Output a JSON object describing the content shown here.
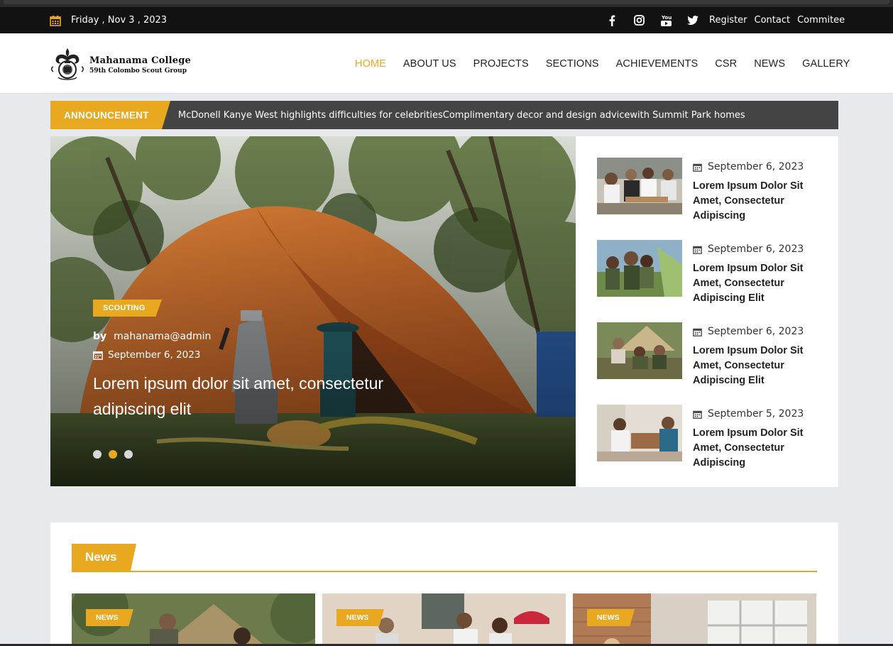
{
  "topbar": {
    "date": "Friday , Nov 3 , 2023",
    "social_icons": [
      "facebook-icon",
      "instagram-icon",
      "youtube-icon",
      "twitter-icon"
    ],
    "youtube_text": "You",
    "links": [
      "Register",
      "Contact",
      "Commitee"
    ]
  },
  "logo": {
    "line1": "Mahanama College",
    "line2": "59th Colombo Scout Group"
  },
  "nav": {
    "items": [
      "HOME",
      "ABOUT US",
      "PROJECTS",
      "SECTIONS",
      "ACHIEVEMENTS",
      "CSR",
      "NEWS",
      "GALLERY"
    ],
    "active": "HOME"
  },
  "announcement": {
    "label": "ANNOUNCEMENT",
    "text": "McDonell Kanye West highlights difficulties for celebritiesComplimentary decor and design advicewith Summit Park homes"
  },
  "hero": {
    "category": "SCOUTING",
    "by_label": "by",
    "author": "mahanama@admin",
    "date": "September 6, 2023",
    "headline": "Lorem ipsum dolor sit amet, consectetur adipiscing elit",
    "slides": 3,
    "active_slide": 2
  },
  "side_posts": [
    {
      "date": "September 6, 2023",
      "title": "Lorem Ipsum Dolor Sit Amet, Consectetur Adipiscing"
    },
    {
      "date": "September 6, 2023",
      "title": "Lorem Ipsum Dolor Sit Amet, Consectetur Adipiscing Elit"
    },
    {
      "date": "September 6, 2023",
      "title": "Lorem Ipsum Dolor Sit Amet, Consectetur Adipiscing Elit"
    },
    {
      "date": "September 5, 2023",
      "title": "Lorem Ipsum Dolor Sit Amet, Consectetur Adipiscing"
    }
  ],
  "news": {
    "heading": "News",
    "cards": [
      {
        "tag": "NEWS"
      },
      {
        "tag": "NEWS"
      },
      {
        "tag": "NEWS"
      }
    ]
  },
  "colors": {
    "accent": "#e8a820",
    "topbar": "#121212",
    "announcement_bg": "#444444"
  }
}
